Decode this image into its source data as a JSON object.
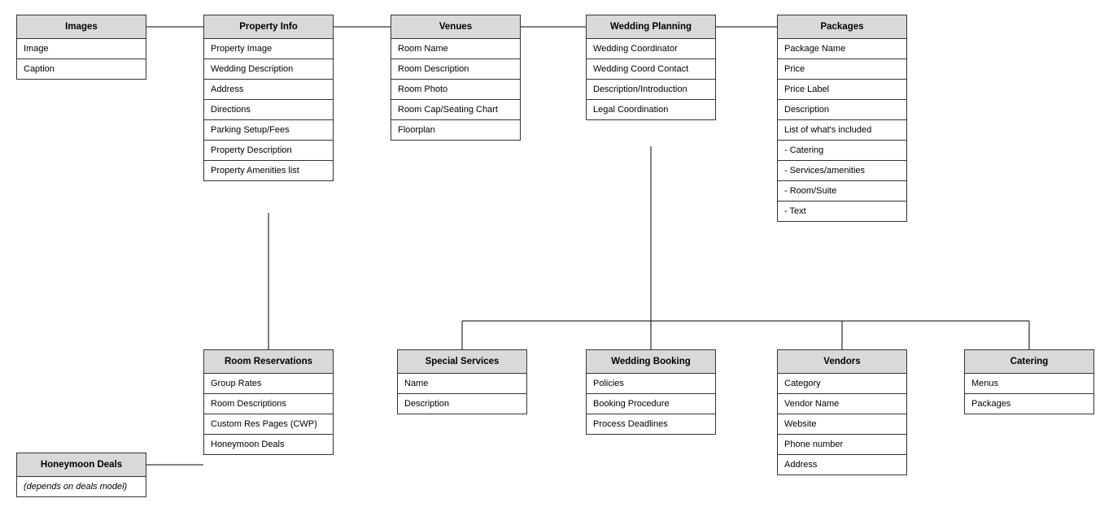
{
  "entities": {
    "images": {
      "title": "Images",
      "rows": [
        "Image",
        "Caption"
      ]
    },
    "propertyInfo": {
      "title": "Property Info",
      "rows": [
        "Property Image",
        "Wedding Description",
        "Address",
        "Directions",
        "Parking Setup/Fees",
        "Property Description",
        "Property Amenities list"
      ]
    },
    "venues": {
      "title": "Venues",
      "rows": [
        "Room Name",
        "Room Description",
        "Room Photo",
        "Room Cap/Seating Chart",
        "Floorplan"
      ]
    },
    "weddingPlanning": {
      "title": "Wedding Planning",
      "rows": [
        "Wedding Coordinator",
        "Wedding Coord Contact",
        "Description/Introduction",
        "Legal Coordination"
      ]
    },
    "packages": {
      "title": "Packages",
      "rows": [
        "Package Name",
        "Price",
        "Price Label",
        "Description",
        "List of what's included",
        " - Catering",
        " - Services/amenities",
        " - Room/Suite",
        " - Text"
      ]
    },
    "roomReservations": {
      "title": "Room Reservations",
      "rows": [
        "Group Rates",
        "Room Descriptions",
        "Custom Res Pages (CWP)",
        "Honeymoon Deals"
      ]
    },
    "honeymoonDeals": {
      "title": "Honeymoon Deals",
      "note": "(depends on deals model)"
    },
    "specialServices": {
      "title": "Special Services",
      "rows": [
        "Name",
        "Description"
      ]
    },
    "weddingBooking": {
      "title": "Wedding Booking",
      "rows": [
        "Policies",
        "Booking Procedure",
        "Process Deadlines"
      ]
    },
    "vendors": {
      "title": "Vendors",
      "rows": [
        "Category",
        "Vendor Name",
        "Website",
        "Phone number",
        "Address"
      ]
    },
    "catering": {
      "title": "Catering",
      "rows": [
        "Menus",
        "Packages"
      ]
    }
  }
}
